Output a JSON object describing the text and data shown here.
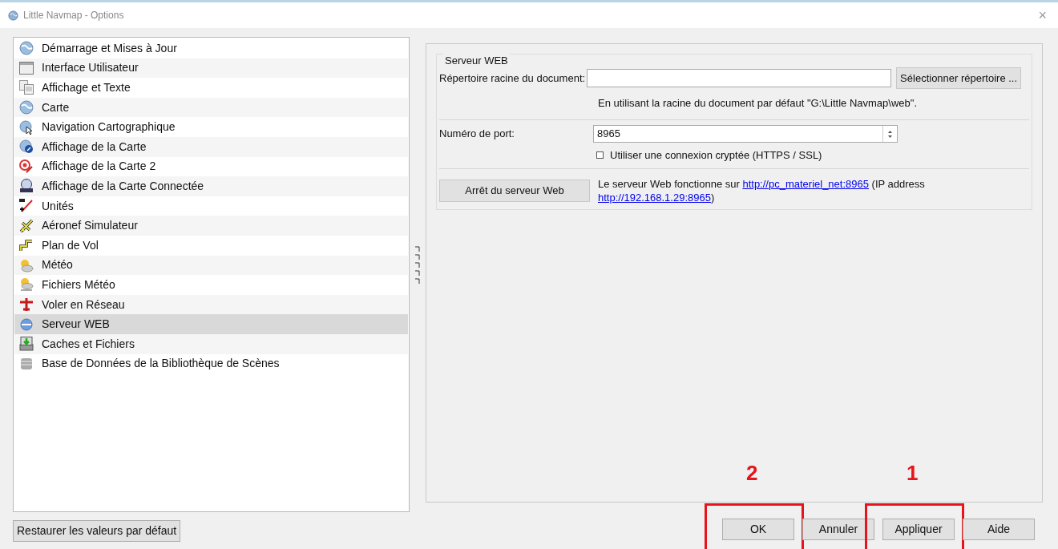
{
  "window": {
    "title": "Little Navmap - Options",
    "close": "×"
  },
  "sidebar": {
    "items": [
      {
        "label": "Démarrage et Mises à Jour",
        "selected": false
      },
      {
        "label": "Interface Utilisateur",
        "selected": false
      },
      {
        "label": "Affichage et Texte",
        "selected": false
      },
      {
        "label": "Carte",
        "selected": false
      },
      {
        "label": "Navigation Cartographique",
        "selected": false
      },
      {
        "label": "Affichage de la Carte",
        "selected": false
      },
      {
        "label": "Affichage de la Carte 2",
        "selected": false
      },
      {
        "label": "Affichage de la Carte Connectée",
        "selected": false
      },
      {
        "label": "Unités",
        "selected": false
      },
      {
        "label": "Aéronef Simulateur",
        "selected": false
      },
      {
        "label": "Plan de Vol",
        "selected": false
      },
      {
        "label": "Météo",
        "selected": false
      },
      {
        "label": "Fichiers Météo",
        "selected": false
      },
      {
        "label": "Voler en Réseau",
        "selected": false
      },
      {
        "label": "Serveur WEB",
        "selected": true
      },
      {
        "label": "Caches et Fichiers",
        "selected": false
      },
      {
        "label": "Base de Données de la Bibliothèque de Scènes",
        "selected": false
      }
    ]
  },
  "web_server": {
    "group_title": "Serveur WEB",
    "document_root": {
      "label": "Répertoire racine du document:",
      "button": "Sélectionner répertoire ..."
    },
    "default_root_note": "En utilisant la racine du document par défaut \"G:\\Little Navmap\\web\".",
    "port": {
      "label": "Numéro de port:",
      "value": "8965"
    },
    "encrypted": {
      "label": "Utiliser une connexion cryptée (HTTPS / SSL)",
      "checked": false
    },
    "stop_button": "Arrêt du serveur Web",
    "status": {
      "before": "Le serveur Web fonctionne sur",
      "link": "http://pc_materiel_net:8965",
      "middle": "(IP address",
      "ip_link": "http://192.168.1.29:8965",
      "after": ")"
    }
  },
  "footer": {
    "restore_button": "Restaurer les valeurs par défaut",
    "buttons": [
      {
        "label": "OK",
        "annotation": "2"
      },
      {
        "label": "Annuler"
      },
      {
        "label": "Appliquer",
        "annotation": "1"
      },
      {
        "label": "Aide"
      }
    ]
  }
}
